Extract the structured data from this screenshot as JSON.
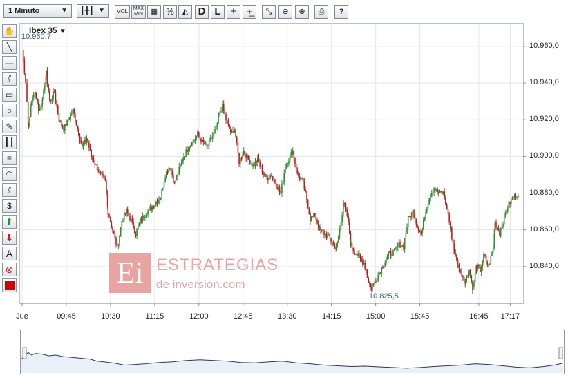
{
  "toolbar": {
    "interval_label": "1 Minuto",
    "vol_label": "VOL",
    "maxmin_label": "MAX\nMIN",
    "percent_label": "%",
    "d_label": "D",
    "l_label": "L",
    "help_label": "?"
  },
  "logo": {
    "mark": "Ei",
    "line1": "ESTRATEGIAS",
    "line2": "de inversion.com"
  },
  "colors": {
    "up": "#2e8b2e",
    "down": "#b22222",
    "grid": "#e3e6ea",
    "nav_fill": "#eaf0f7",
    "nav_line": "#2a3a55"
  },
  "chart_data": {
    "type": "candlestick",
    "title": "Ibex 35",
    "high_label": "10.960,7",
    "low_label": "10.825,5",
    "ylim": [
      10820,
      10972
    ],
    "yticks": [
      "10.960,0",
      "10.940,0",
      "10.920,0",
      "10.900,0",
      "10.880,0",
      "10.860,0",
      "10.840,0"
    ],
    "ytick_values": [
      10960,
      10940,
      10920,
      10900,
      10880,
      10860,
      10840
    ],
    "xticks": [
      "Jue",
      "09:45",
      "10:30",
      "11:15",
      "12:00",
      "12:45",
      "13:30",
      "14:15",
      "15:00",
      "15:45",
      "16:45",
      "17:17"
    ],
    "xtick_minutes": [
      0,
      45,
      90,
      135,
      180,
      225,
      270,
      315,
      360,
      405,
      465,
      497
    ],
    "x_minutes_max": 505,
    "price_path": [
      [
        0,
        10958
      ],
      [
        4,
        10940
      ],
      [
        7,
        10915
      ],
      [
        10,
        10930
      ],
      [
        14,
        10935
      ],
      [
        18,
        10925
      ],
      [
        22,
        10930
      ],
      [
        26,
        10945
      ],
      [
        30,
        10930
      ],
      [
        35,
        10935
      ],
      [
        40,
        10920
      ],
      [
        45,
        10915
      ],
      [
        50,
        10920
      ],
      [
        55,
        10925
      ],
      [
        60,
        10915
      ],
      [
        65,
        10905
      ],
      [
        70,
        10910
      ],
      [
        75,
        10900
      ],
      [
        80,
        10895
      ],
      [
        85,
        10890
      ],
      [
        90,
        10886
      ],
      [
        93,
        10870
      ],
      [
        98,
        10860
      ],
      [
        103,
        10850
      ],
      [
        108,
        10865
      ],
      [
        113,
        10870
      ],
      [
        118,
        10865
      ],
      [
        123,
        10858
      ],
      [
        128,
        10865
      ],
      [
        135,
        10870
      ],
      [
        140,
        10872
      ],
      [
        145,
        10875
      ],
      [
        150,
        10878
      ],
      [
        155,
        10890
      ],
      [
        160,
        10895
      ],
      [
        165,
        10885
      ],
      [
        170,
        10893
      ],
      [
        175,
        10900
      ],
      [
        180,
        10905
      ],
      [
        185,
        10908
      ],
      [
        190,
        10912
      ],
      [
        195,
        10908
      ],
      [
        200,
        10905
      ],
      [
        205,
        10910
      ],
      [
        210,
        10915
      ],
      [
        213,
        10922
      ],
      [
        217,
        10927
      ],
      [
        222,
        10918
      ],
      [
        227,
        10912
      ],
      [
        230,
        10915
      ],
      [
        235,
        10897
      ],
      [
        240,
        10903
      ],
      [
        245,
        10898
      ],
      [
        250,
        10895
      ],
      [
        255,
        10898
      ],
      [
        260,
        10892
      ],
      [
        265,
        10888
      ],
      [
        270,
        10890
      ],
      [
        275,
        10885
      ],
      [
        280,
        10880
      ],
      [
        285,
        10895
      ],
      [
        290,
        10900
      ],
      [
        293,
        10903
      ],
      [
        298,
        10890
      ],
      [
        303,
        10887
      ],
      [
        307,
        10880
      ],
      [
        312,
        10866
      ],
      [
        317,
        10868
      ],
      [
        322,
        10860
      ],
      [
        327,
        10858
      ],
      [
        332,
        10856
      ],
      [
        336,
        10853
      ],
      [
        340,
        10850
      ],
      [
        344,
        10860
      ],
      [
        348,
        10875
      ],
      [
        352,
        10868
      ],
      [
        356,
        10852
      ],
      [
        360,
        10848
      ],
      [
        365,
        10845
      ],
      [
        370,
        10842
      ],
      [
        375,
        10832
      ],
      [
        378,
        10828
      ],
      [
        383,
        10833
      ],
      [
        388,
        10838
      ],
      [
        393,
        10843
      ],
      [
        398,
        10847
      ],
      [
        403,
        10848
      ],
      [
        408,
        10852
      ],
      [
        413,
        10851
      ],
      [
        418,
        10866
      ],
      [
        423,
        10870
      ],
      [
        428,
        10862
      ],
      [
        432,
        10858
      ],
      [
        437,
        10870
      ],
      [
        441,
        10878
      ],
      [
        446,
        10883
      ],
      [
        451,
        10880
      ],
      [
        456,
        10880
      ],
      [
        460,
        10872
      ],
      [
        464,
        10860
      ],
      [
        468,
        10848
      ],
      [
        472,
        10840
      ],
      [
        476,
        10836
      ],
      [
        480,
        10832
      ],
      [
        484,
        10838
      ],
      [
        488,
        10828
      ],
      [
        492,
        10840
      ],
      [
        496,
        10838
      ],
      [
        500,
        10846
      ],
      [
        505,
        10840
      ],
      [
        510,
        10850
      ],
      [
        512,
        10864
      ],
      [
        517,
        10858
      ],
      [
        522,
        10867
      ],
      [
        527,
        10874
      ],
      [
        532,
        10878
      ],
      [
        537,
        10879
      ]
    ],
    "overview_path": [
      [
        0,
        0.72
      ],
      [
        6,
        0.58
      ],
      [
        10,
        0.52
      ],
      [
        15,
        0.6
      ],
      [
        20,
        0.55
      ],
      [
        30,
        0.57
      ],
      [
        40,
        0.62
      ],
      [
        50,
        0.6
      ],
      [
        60,
        0.64
      ],
      [
        80,
        0.68
      ],
      [
        100,
        0.72
      ],
      [
        110,
        0.78
      ],
      [
        120,
        0.8
      ],
      [
        135,
        0.84
      ],
      [
        150,
        0.9
      ],
      [
        165,
        0.88
      ],
      [
        180,
        0.86
      ],
      [
        200,
        0.82
      ],
      [
        220,
        0.8
      ],
      [
        240,
        0.76
      ],
      [
        260,
        0.74
      ],
      [
        280,
        0.76
      ],
      [
        300,
        0.78
      ],
      [
        320,
        0.82
      ],
      [
        340,
        0.83
      ],
      [
        360,
        0.8
      ],
      [
        380,
        0.78
      ],
      [
        400,
        0.83
      ],
      [
        420,
        0.86
      ],
      [
        440,
        0.9
      ],
      [
        460,
        0.92
      ],
      [
        480,
        0.94
      ],
      [
        500,
        0.93
      ],
      [
        520,
        0.95
      ],
      [
        540,
        0.97
      ],
      [
        560,
        0.99
      ],
      [
        580,
        0.97
      ],
      [
        600,
        0.94
      ],
      [
        620,
        0.92
      ],
      [
        640,
        0.9
      ],
      [
        660,
        0.86
      ],
      [
        680,
        0.88
      ],
      [
        700,
        0.92
      ],
      [
        720,
        0.96
      ],
      [
        740,
        0.98
      ],
      [
        760,
        0.94
      ],
      [
        775,
        0.9
      ],
      [
        788,
        0.84
      ]
    ]
  }
}
